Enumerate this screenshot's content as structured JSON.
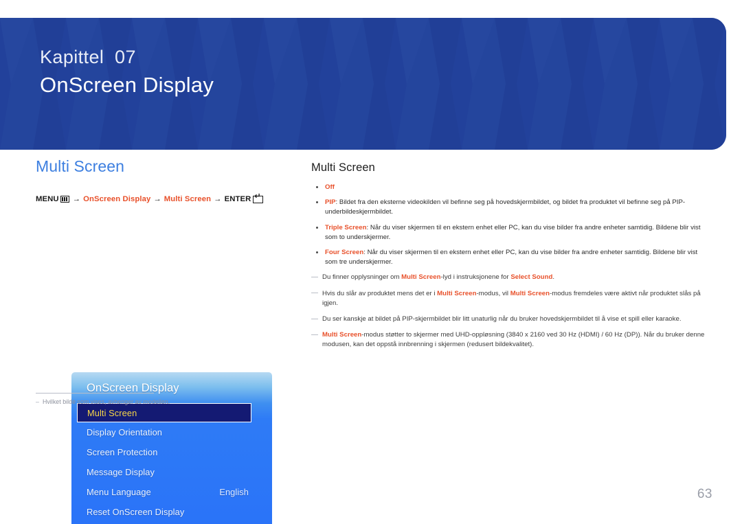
{
  "header": {
    "chapter": "Kapittel  07",
    "title": "OnScreen Display",
    "bg_color": "#22419b"
  },
  "left": {
    "section_heading": "Multi Screen",
    "accent_color": "#3d7fe0",
    "breadcrumb": {
      "menu_label": "MENU",
      "menu_icon": "menu-bars-icon",
      "arrow": "→",
      "step1": "OnScreen Display",
      "step2": "Multi Screen",
      "enter_label": "ENTER",
      "enter_icon": "enter-return-icon",
      "accent_color": "#e8502a"
    },
    "osd": {
      "title": "OnScreen Display",
      "rows": [
        {
          "label": "Multi Screen",
          "value": "",
          "selected": true
        },
        {
          "label": "Display Orientation",
          "value": "",
          "selected": false
        },
        {
          "label": "Screen Protection",
          "value": "",
          "selected": false
        },
        {
          "label": "Message Display",
          "value": "",
          "selected": false
        },
        {
          "label": "Menu Language",
          "value": "English",
          "selected": false
        },
        {
          "label": "Reset OnScreen Display",
          "value": "",
          "selected": false
        }
      ],
      "selected_text_color": "#f7d648",
      "selected_bg_color": "#141a73"
    },
    "footnote": {
      "dash": "–",
      "text": "Hvilket bilde som vises, avhenger av modellen."
    }
  },
  "right": {
    "title": "Multi Screen",
    "options": [
      {
        "term": "Off",
        "separator": "",
        "body": ""
      },
      {
        "term": "PIP",
        "separator": ": ",
        "body": "Bildet fra den eksterne videokilden vil befinne seg på hovedskjermbildet, og bildet fra produktet vil befinne seg på PIP-underbildeskjermbildet."
      },
      {
        "term": "Triple Screen",
        "separator": ": ",
        "body": "Når du viser skjermen til en ekstern enhet eller PC, kan du vise bilder fra andre enheter samtidig. Bildene blir vist som to underskjermer."
      },
      {
        "term": "Four Screen",
        "separator": ": ",
        "body": "Når du viser skjermen til en ekstern enhet eller PC, kan du vise bilder fra andre enheter samtidig. Bildene blir vist som tre underskjermer."
      }
    ],
    "notes": [
      {
        "marker": "—",
        "segments": [
          {
            "text": "Du finner opplysninger om ",
            "accent": false
          },
          {
            "text": "Multi Screen",
            "accent": true
          },
          {
            "text": "-lyd i instruksjonene for ",
            "accent": false
          },
          {
            "text": "Select Sound",
            "accent": true
          },
          {
            "text": ".",
            "accent": false
          }
        ]
      },
      {
        "marker": "—",
        "segments": [
          {
            "text": "Hvis du slår av produktet mens det er i ",
            "accent": false
          },
          {
            "text": "Multi Screen",
            "accent": true
          },
          {
            "text": "-modus, vil ",
            "accent": false
          },
          {
            "text": "Multi Screen",
            "accent": true
          },
          {
            "text": "-modus fremdeles være aktivt når produktet slås på igjen.",
            "accent": false
          }
        ]
      },
      {
        "marker": "—",
        "segments": [
          {
            "text": "Du ser kanskje at bildet på PIP-skjermbildet blir litt unaturlig når du bruker hovedskjermbildet til å vise et spill eller karaoke.",
            "accent": false
          }
        ]
      },
      {
        "marker": "—",
        "segments": [
          {
            "text": "Multi Screen",
            "accent": true
          },
          {
            "text": "-modus støtter to skjermer med UHD-oppløsning (3840 x 2160 ved 30 Hz (HDMI) / 60 Hz (DP)). Når du bruker denne modusen, kan det oppstå innbrenning i skjermen (redusert bildekvalitet).",
            "accent": false
          }
        ]
      }
    ],
    "accent_color": "#e8502a"
  },
  "page_number": "63"
}
